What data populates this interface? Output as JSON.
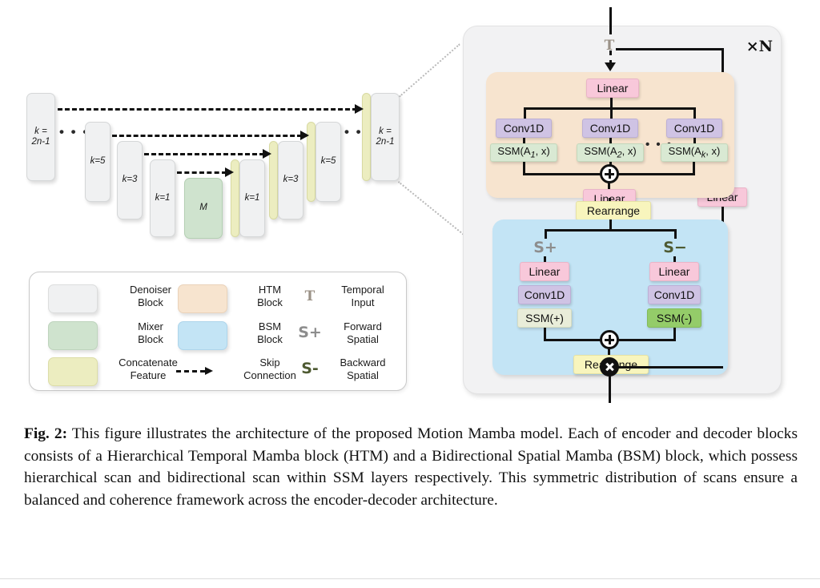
{
  "figure": {
    "caption_label": "Fig. 2:",
    "caption_text": " This figure illustrates the architecture of the proposed Motion Mamba model. Each of encoder and decoder blocks consists of a Hierarchical Temporal Mamba block (HTM) and a Bidirectional Spatial Mamba (BSM) block, which possess hierarchical scan and bidirectional scan within SSM layers respectively. This symmetric distribution of scans ensure a balanced and coherence framework across the encoder-decoder architecture."
  },
  "unet": {
    "encoder_blocks": [
      {
        "label_line1": "k =",
        "label_line2": "2n-1",
        "type": "denoiser"
      },
      {
        "label_line1": "k=5",
        "label_line2": "",
        "type": "denoiser"
      },
      {
        "label_line1": "k=3",
        "label_line2": "",
        "type": "denoiser"
      },
      {
        "label_line1": "k=1",
        "label_line2": "",
        "type": "denoiser"
      }
    ],
    "mixer_block": {
      "label_line1": "M",
      "label_line2": "",
      "type": "mixer"
    },
    "decoder_blocks": [
      {
        "label_line1": "k=1",
        "label_line2": "",
        "type": "denoiser"
      },
      {
        "label_line1": "k=3",
        "label_line2": "",
        "type": "denoiser"
      },
      {
        "label_line1": "k=5",
        "label_line2": "",
        "type": "denoiser"
      },
      {
        "label_line1": "k =",
        "label_line2": "2n-1",
        "type": "denoiser"
      }
    ],
    "encoder_ellipsis": "• • •",
    "decoder_ellipsis": "• • •"
  },
  "legend": {
    "items": [
      {
        "swatch": "denoiser",
        "line1": "Denoiser",
        "line2": "Block"
      },
      {
        "swatch": "htm",
        "line1": "HTM",
        "line2": "Block"
      },
      {
        "symbol": "T",
        "line1": "Temporal",
        "line2": "Input"
      },
      {
        "swatch": "mixer",
        "line1": "Mixer",
        "line2": "Block"
      },
      {
        "swatch": "bsm",
        "line1": "BSM",
        "line2": "Block"
      },
      {
        "symbol": "S+",
        "line1": "Forward",
        "line2": "Spatial"
      },
      {
        "swatch": "concat",
        "line1": "Concatenate",
        "line2": "Feature"
      },
      {
        "symbol": "dashed-arrow",
        "line1": "Skip",
        "line2": "Connection"
      },
      {
        "symbol": "S-",
        "line1": "Backward",
        "line2": "Spatial"
      }
    ]
  },
  "detail": {
    "repeat_label": "×N",
    "temporal_input_symbol": "T",
    "htm": {
      "input_linear": "Linear",
      "branches": [
        {
          "conv": "Conv1D",
          "ssm_prefix": "SSM(A",
          "ssm_sub": "1",
          "ssm_suffix": ", x)"
        },
        {
          "conv": "Conv1D",
          "ssm_prefix": "SSM(A",
          "ssm_sub": "2",
          "ssm_suffix": ", x)"
        },
        {
          "conv": "Conv1D",
          "ssm_prefix": "SSM(A",
          "ssm_sub": "k",
          "ssm_suffix": ", x)"
        }
      ],
      "branch_ellipsis": "• • •",
      "output_linear": "Linear"
    },
    "rearrange_top": "Rearrange",
    "bsm": {
      "forward_symbol": "S+",
      "backward_symbol": "S−",
      "forward": {
        "linear": "Linear",
        "conv": "Conv1D",
        "ssm": "SSM(+)"
      },
      "backward": {
        "linear": "Linear",
        "conv": "Conv1D",
        "ssm": "SSM(-)"
      }
    },
    "rearrange_bottom": "Rearrange",
    "skip_linear": "Linear",
    "add_operator": "⊕",
    "multiply_operator": "⊗"
  },
  "colors": {
    "denoiser": "#f0f1f2",
    "mixer": "#cfe3ce",
    "concat": "#ecedc0",
    "htm": "#f7e4cf",
    "bsm": "#c3e4f5",
    "linear": "#f8c8da",
    "conv1d": "#cfc3e4",
    "ssm": "#d9e9d3",
    "ssm_dark": "#94cc69",
    "rearrange": "#f8f5bd",
    "panel": "#f2f2f3",
    "wire": "#111111"
  }
}
